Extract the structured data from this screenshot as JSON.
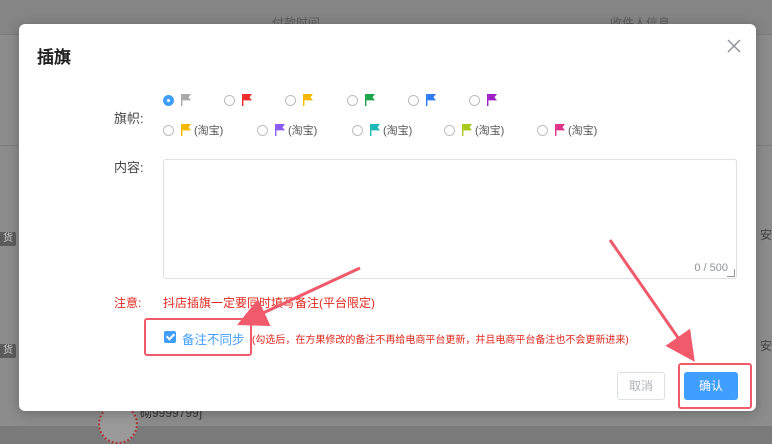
{
  "background": {
    "col_headers": [
      "付款时间",
      "收件人信息"
    ],
    "row_tags": [
      "货",
      "货"
    ],
    "right_snippets": [
      "安",
      "安"
    ],
    "id_text": "砌9999799]"
  },
  "dialog": {
    "title": "插旗",
    "flag_label": "旗帜:",
    "flags": [
      {
        "color": "#aaaaaa",
        "checked": true,
        "sub": ""
      },
      {
        "color": "#ee2b2b",
        "checked": false,
        "sub": ""
      },
      {
        "color": "#f5b800",
        "checked": false,
        "sub": ""
      },
      {
        "color": "#1aa34a",
        "checked": false,
        "sub": ""
      },
      {
        "color": "#2f7cf6",
        "checked": false,
        "sub": ""
      },
      {
        "color": "#a020c8",
        "checked": false,
        "sub": ""
      },
      {
        "color": "#f5b800",
        "checked": false,
        "sub": "(淘宝)"
      },
      {
        "color": "#8a5cf5",
        "checked": false,
        "sub": "(淘宝)"
      },
      {
        "color": "#19b7b7",
        "checked": false,
        "sub": "(淘宝)"
      },
      {
        "color": "#a6c91b",
        "checked": false,
        "sub": "(淘宝)"
      },
      {
        "color": "#e0338c",
        "checked": false,
        "sub": "(淘宝)"
      }
    ],
    "content_label": "内容:",
    "content_value": "",
    "counter": "0 / 500",
    "note_label": "注意:",
    "note_text": "抖店插旗一定要同时填写备注(平台限定)",
    "sync_checked": true,
    "sync_label": "备注不同步",
    "sync_hint": "(勾选后，在方果修改的备注不再给电商平台更新，并且电商平台备注也不会更新进来)",
    "cancel_label": "取消",
    "confirm_label": "确认"
  },
  "colors": {
    "primary": "#409eff",
    "danger": "#e0281e",
    "highlight": "#f05a6b"
  }
}
